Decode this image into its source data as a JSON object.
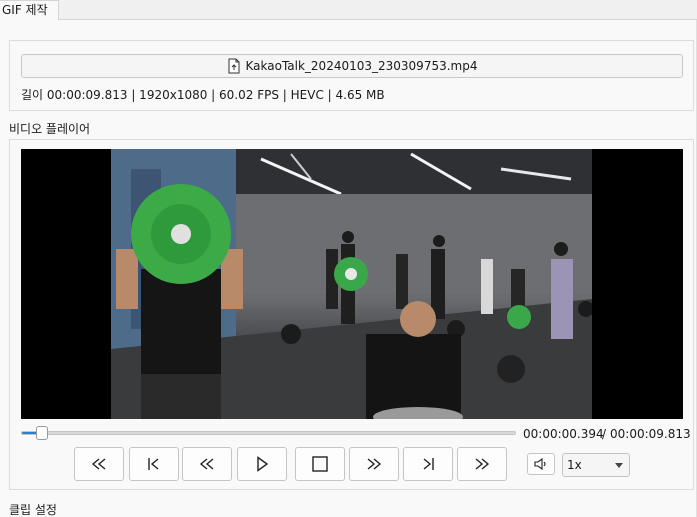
{
  "tabs": [
    {
      "label": "GIF 제작"
    }
  ],
  "file": {
    "button_label": "KakaoTalk_20240103_230309753.mp4",
    "info": "길이 00:00:09.813 | 1920x1080 | 60.02 FPS | HEVC | 4.65 MB"
  },
  "player": {
    "section_label": "비디오 플레이어",
    "current_time": "00:00:00.394",
    "separator": "/",
    "total_time": "00:00:09.813",
    "progress_fraction": 0.04,
    "controls": [
      {
        "name": "skip-back-far-button",
        "icon": "double-left-icon"
      },
      {
        "name": "go-to-start-button",
        "icon": "skip-start-icon"
      },
      {
        "name": "rewind-button",
        "icon": "double-left-icon"
      },
      {
        "name": "play-button",
        "icon": "play-icon"
      },
      {
        "name": "stop-button",
        "icon": "stop-icon"
      },
      {
        "name": "fast-forward-button",
        "icon": "double-right-icon"
      },
      {
        "name": "go-to-end-button",
        "icon": "skip-end-icon"
      },
      {
        "name": "skip-forward-far-button",
        "icon": "double-right-icon"
      }
    ],
    "volume_icon": "speaker-icon",
    "speed": "1x"
  },
  "clip": {
    "section_label": "클립 설정"
  }
}
